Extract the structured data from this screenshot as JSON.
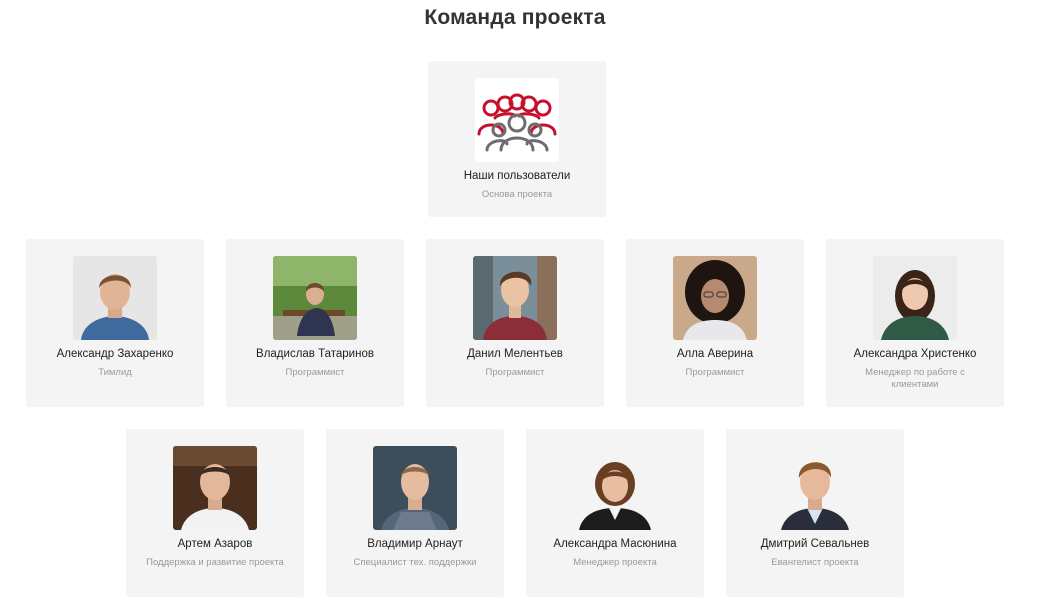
{
  "title": "Команда проекта",
  "top": {
    "name": "Наши пользователи",
    "role": "Основа проекта",
    "icon": "users-group-icon",
    "accent": "#c8102e"
  },
  "members": [
    {
      "name": "Александр Захаренко",
      "role": "Тимлид"
    },
    {
      "name": "Владислав Татаринов",
      "role": "Программист"
    },
    {
      "name": "Данил Мелентьев",
      "role": "Программист"
    },
    {
      "name": "Алла Аверина",
      "role": "Программист"
    },
    {
      "name": "Александра Христенко",
      "role": "Менеджер по работе с клиентами"
    },
    {
      "name": "Артем Азаров",
      "role": "Поддержка и развитие проекта"
    },
    {
      "name": "Владимир Арнаут",
      "role": "Специалист тех. поддержки"
    },
    {
      "name": "Александра Масюнина",
      "role": "Менеджер проекта"
    },
    {
      "name": "Дмитрий Севальнев",
      "role": "Евангелист проекта"
    }
  ]
}
